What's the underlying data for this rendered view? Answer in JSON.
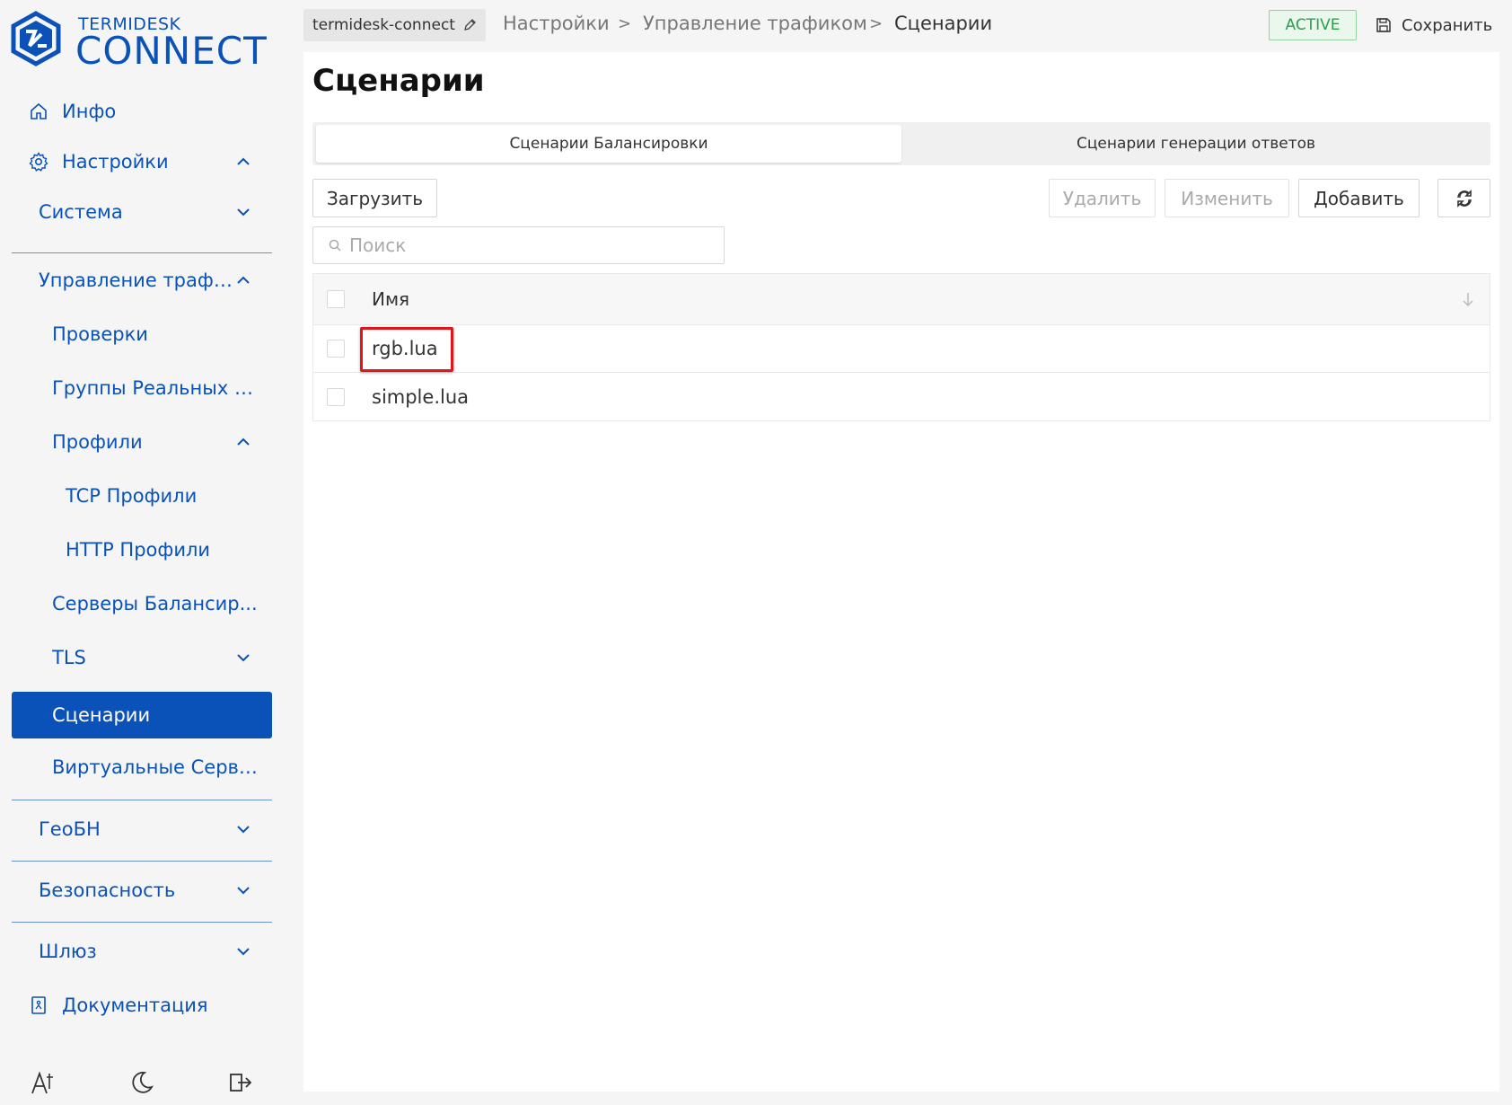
{
  "app": {
    "brand_top": "TERMIDESK",
    "brand_main": "CONNECT"
  },
  "sidebar": {
    "items": [
      {
        "label": "Инфо"
      },
      {
        "label": "Настройки"
      },
      {
        "label": "Система"
      },
      {
        "label": "Управление трафи..."
      },
      {
        "label": "Проверки"
      },
      {
        "label": "Группы Реальных С..."
      },
      {
        "label": "Профили"
      },
      {
        "label": "TCP Профили"
      },
      {
        "label": "HTTP Профили"
      },
      {
        "label": "Серверы Балансир..."
      },
      {
        "label": "TLS"
      },
      {
        "label": "Сценарии"
      },
      {
        "label": "Виртуальные Серве..."
      },
      {
        "label": "ГеоБН"
      },
      {
        "label": "Безопасность"
      },
      {
        "label": "Шлюз"
      },
      {
        "label": "Документация"
      }
    ],
    "active": "Сценарии"
  },
  "topbar": {
    "project": "termidesk-connect",
    "breadcrumbs": [
      "Настройки",
      "Управление трафиком",
      "Сценарии"
    ],
    "separator": ">",
    "status": "ACTIVE",
    "save_label": "Сохранить"
  },
  "main": {
    "title": "Сценарии",
    "tabs": [
      {
        "label": "Сценарии Балансировки",
        "active": true
      },
      {
        "label": "Сценарии генерации ответов",
        "active": false
      }
    ],
    "toolbar": {
      "upload": "Загрузить",
      "delete": "Удалить",
      "edit": "Изменить",
      "add": "Добавить"
    },
    "search": {
      "placeholder": "Поиск",
      "value": ""
    },
    "table": {
      "header": "Имя",
      "rows": [
        {
          "name": "rgb.lua"
        },
        {
          "name": "simple.lua"
        }
      ]
    }
  },
  "colors": {
    "accent": "#0a52b8",
    "status_green": "#2f9e4f",
    "highlight_red": "#e0161b"
  }
}
